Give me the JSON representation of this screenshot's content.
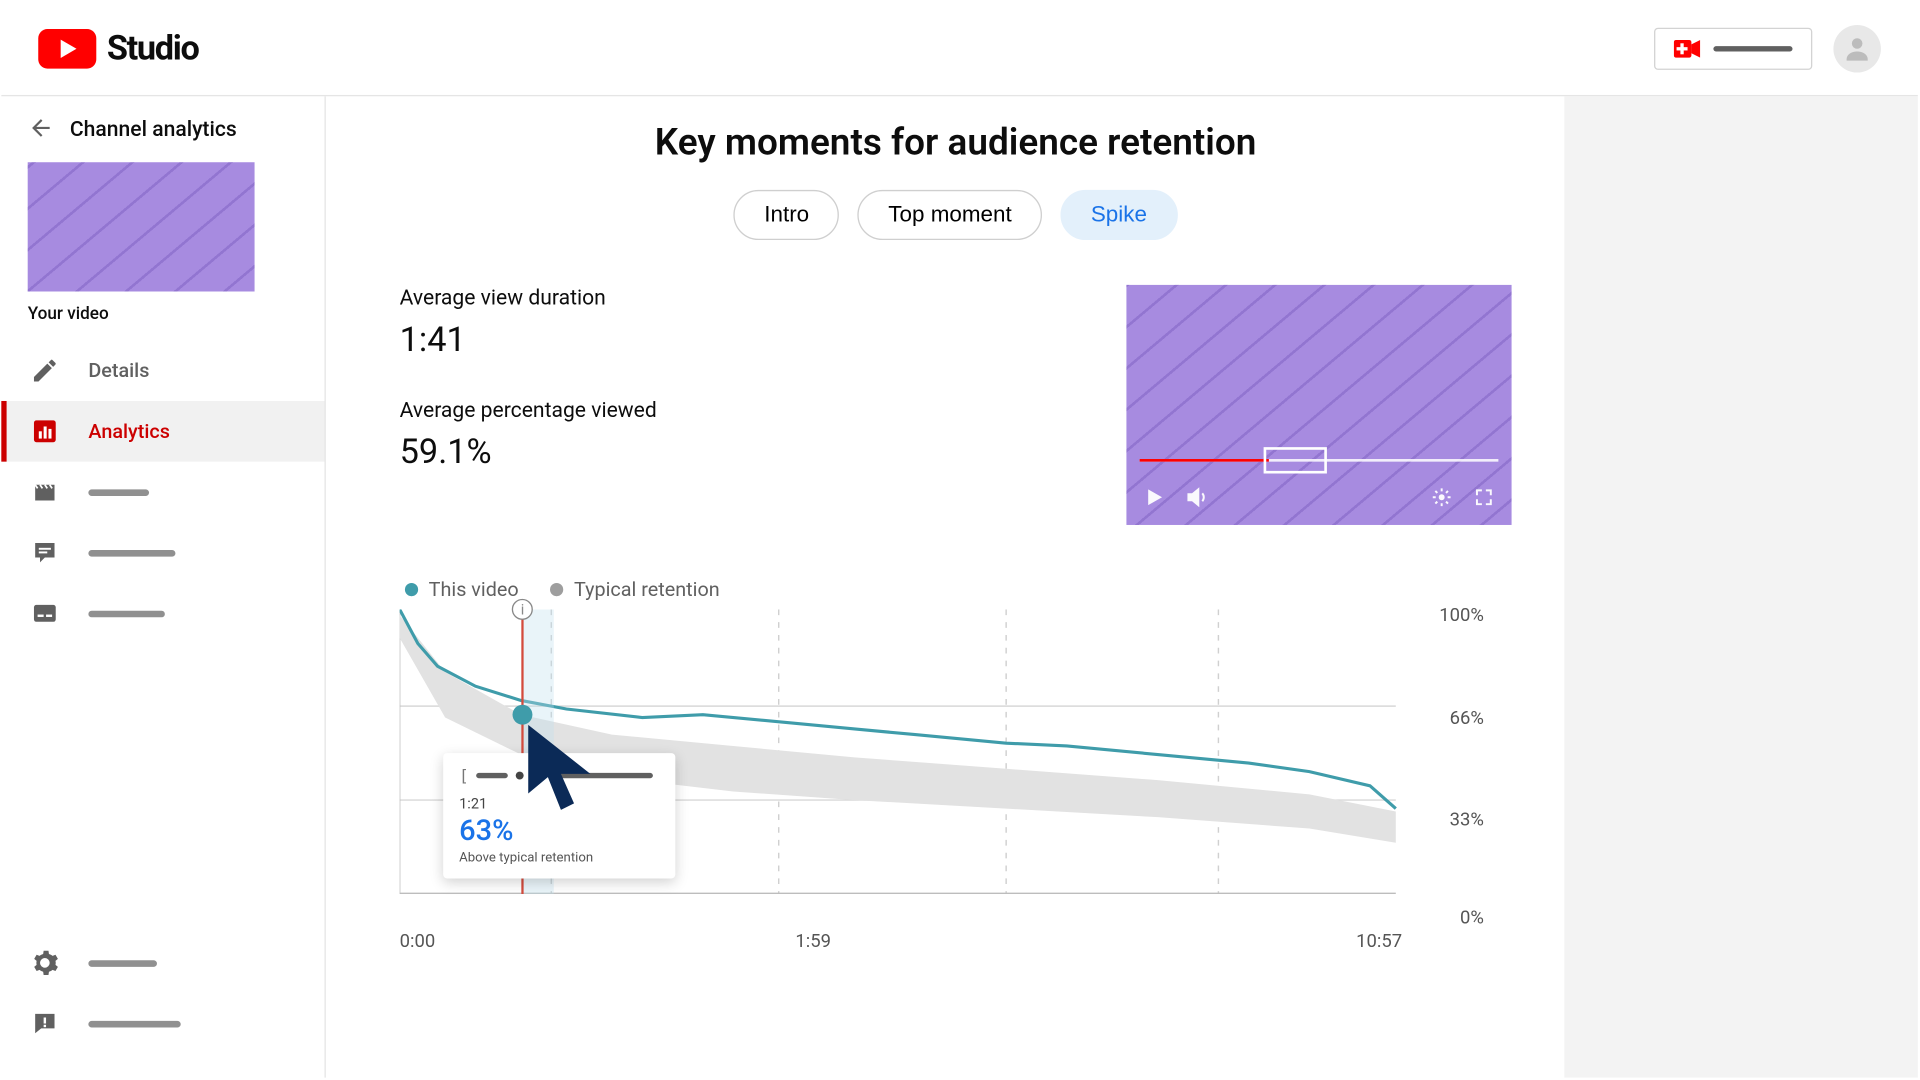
{
  "app": {
    "name": "Studio"
  },
  "sidebar": {
    "back_label": "Channel analytics",
    "your_video_label": "Your video",
    "items": [
      {
        "id": "details",
        "label": "Details"
      },
      {
        "id": "analytics",
        "label": "Analytics"
      }
    ]
  },
  "page": {
    "title": "Key moments for audience retention",
    "tabs": [
      {
        "id": "intro",
        "label": "Intro"
      },
      {
        "id": "top",
        "label": "Top moment"
      },
      {
        "id": "spike",
        "label": "Spike",
        "active": true
      }
    ],
    "stats": {
      "avg_view_duration_label": "Average view duration",
      "avg_view_duration_value": "1:41",
      "avg_pct_viewed_label": "Average percentage viewed",
      "avg_pct_viewed_value": "59.1%"
    },
    "legend": {
      "this_video": "This video",
      "typical": "Typical retention"
    }
  },
  "tooltip": {
    "time": "1:21",
    "percent": "63%",
    "note": "Above typical retention"
  },
  "colors": {
    "accent_red": "#cc0000",
    "line": "#3f9caa",
    "band": "#d9d9d9",
    "blue": "#1a73e8",
    "navy": "#0b2a57"
  },
  "chart_data": {
    "type": "line",
    "xlabel": "",
    "ylabel": "",
    "x_ticks": [
      "0:00",
      "1:59",
      "10:57"
    ],
    "y_ticks": [
      "0%",
      "33%",
      "66%",
      "100%"
    ],
    "ylim": [
      0,
      100
    ],
    "x_range_seconds": [
      0,
      657
    ],
    "marker": {
      "time": "1:21",
      "seconds": 81,
      "value": 63
    },
    "series": [
      {
        "name": "This video",
        "x_seconds": [
          0,
          12,
          25,
          50,
          80,
          110,
          160,
          200,
          260,
          300,
          340,
          400,
          440,
          500,
          560,
          600,
          640,
          657
        ],
        "values": [
          100,
          88,
          80,
          73,
          68,
          65,
          62,
          63,
          60,
          58,
          56,
          53,
          52,
          49,
          46,
          43,
          38,
          30
        ]
      }
    ],
    "band": {
      "name": "Typical retention",
      "x_seconds": [
        0,
        30,
        80,
        140,
        220,
        300,
        400,
        500,
        600,
        657
      ],
      "upper": [
        98,
        78,
        63,
        56,
        52,
        48,
        44,
        40,
        35,
        29
      ],
      "lower": [
        90,
        62,
        49,
        41,
        36,
        33,
        30,
        27,
        23,
        18
      ]
    }
  }
}
